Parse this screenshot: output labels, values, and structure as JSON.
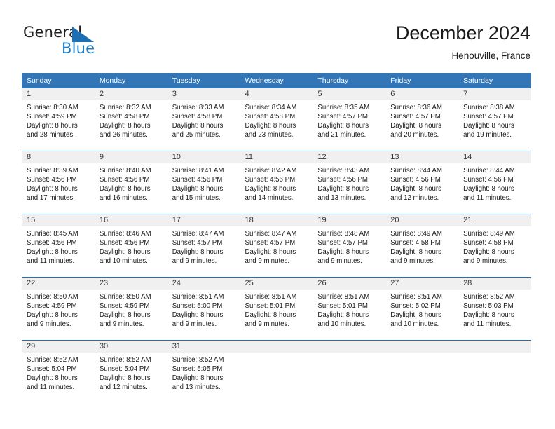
{
  "brand": {
    "name_part1": "General",
    "name_part2": "Blue",
    "flag_icon": "blue-triangle-flag-icon"
  },
  "header": {
    "title": "December 2024",
    "location": "Henouville, France"
  },
  "colors": {
    "header_blue": "#3376b8",
    "rule_blue": "#2b6cad",
    "daynum_band": "#f0f0f0",
    "brand_blue": "#1c7ec6"
  },
  "weekday_headers": [
    "Sunday",
    "Monday",
    "Tuesday",
    "Wednesday",
    "Thursday",
    "Friday",
    "Saturday"
  ],
  "weeks": [
    {
      "days": [
        {
          "day": "1",
          "sunrise": "Sunrise: 8:30 AM",
          "sunset": "Sunset: 4:59 PM",
          "daylight1": "Daylight: 8 hours",
          "daylight2": "and 28 minutes."
        },
        {
          "day": "2",
          "sunrise": "Sunrise: 8:32 AM",
          "sunset": "Sunset: 4:58 PM",
          "daylight1": "Daylight: 8 hours",
          "daylight2": "and 26 minutes."
        },
        {
          "day": "3",
          "sunrise": "Sunrise: 8:33 AM",
          "sunset": "Sunset: 4:58 PM",
          "daylight1": "Daylight: 8 hours",
          "daylight2": "and 25 minutes."
        },
        {
          "day": "4",
          "sunrise": "Sunrise: 8:34 AM",
          "sunset": "Sunset: 4:58 PM",
          "daylight1": "Daylight: 8 hours",
          "daylight2": "and 23 minutes."
        },
        {
          "day": "5",
          "sunrise": "Sunrise: 8:35 AM",
          "sunset": "Sunset: 4:57 PM",
          "daylight1": "Daylight: 8 hours",
          "daylight2": "and 21 minutes."
        },
        {
          "day": "6",
          "sunrise": "Sunrise: 8:36 AM",
          "sunset": "Sunset: 4:57 PM",
          "daylight1": "Daylight: 8 hours",
          "daylight2": "and 20 minutes."
        },
        {
          "day": "7",
          "sunrise": "Sunrise: 8:38 AM",
          "sunset": "Sunset: 4:57 PM",
          "daylight1": "Daylight: 8 hours",
          "daylight2": "and 19 minutes."
        }
      ]
    },
    {
      "days": [
        {
          "day": "8",
          "sunrise": "Sunrise: 8:39 AM",
          "sunset": "Sunset: 4:56 PM",
          "daylight1": "Daylight: 8 hours",
          "daylight2": "and 17 minutes."
        },
        {
          "day": "9",
          "sunrise": "Sunrise: 8:40 AM",
          "sunset": "Sunset: 4:56 PM",
          "daylight1": "Daylight: 8 hours",
          "daylight2": "and 16 minutes."
        },
        {
          "day": "10",
          "sunrise": "Sunrise: 8:41 AM",
          "sunset": "Sunset: 4:56 PM",
          "daylight1": "Daylight: 8 hours",
          "daylight2": "and 15 minutes."
        },
        {
          "day": "11",
          "sunrise": "Sunrise: 8:42 AM",
          "sunset": "Sunset: 4:56 PM",
          "daylight1": "Daylight: 8 hours",
          "daylight2": "and 14 minutes."
        },
        {
          "day": "12",
          "sunrise": "Sunrise: 8:43 AM",
          "sunset": "Sunset: 4:56 PM",
          "daylight1": "Daylight: 8 hours",
          "daylight2": "and 13 minutes."
        },
        {
          "day": "13",
          "sunrise": "Sunrise: 8:44 AM",
          "sunset": "Sunset: 4:56 PM",
          "daylight1": "Daylight: 8 hours",
          "daylight2": "and 12 minutes."
        },
        {
          "day": "14",
          "sunrise": "Sunrise: 8:44 AM",
          "sunset": "Sunset: 4:56 PM",
          "daylight1": "Daylight: 8 hours",
          "daylight2": "and 11 minutes."
        }
      ]
    },
    {
      "days": [
        {
          "day": "15",
          "sunrise": "Sunrise: 8:45 AM",
          "sunset": "Sunset: 4:56 PM",
          "daylight1": "Daylight: 8 hours",
          "daylight2": "and 11 minutes."
        },
        {
          "day": "16",
          "sunrise": "Sunrise: 8:46 AM",
          "sunset": "Sunset: 4:56 PM",
          "daylight1": "Daylight: 8 hours",
          "daylight2": "and 10 minutes."
        },
        {
          "day": "17",
          "sunrise": "Sunrise: 8:47 AM",
          "sunset": "Sunset: 4:57 PM",
          "daylight1": "Daylight: 8 hours",
          "daylight2": "and 9 minutes."
        },
        {
          "day": "18",
          "sunrise": "Sunrise: 8:47 AM",
          "sunset": "Sunset: 4:57 PM",
          "daylight1": "Daylight: 8 hours",
          "daylight2": "and 9 minutes."
        },
        {
          "day": "19",
          "sunrise": "Sunrise: 8:48 AM",
          "sunset": "Sunset: 4:57 PM",
          "daylight1": "Daylight: 8 hours",
          "daylight2": "and 9 minutes."
        },
        {
          "day": "20",
          "sunrise": "Sunrise: 8:49 AM",
          "sunset": "Sunset: 4:58 PM",
          "daylight1": "Daylight: 8 hours",
          "daylight2": "and 9 minutes."
        },
        {
          "day": "21",
          "sunrise": "Sunrise: 8:49 AM",
          "sunset": "Sunset: 4:58 PM",
          "daylight1": "Daylight: 8 hours",
          "daylight2": "and 9 minutes."
        }
      ]
    },
    {
      "days": [
        {
          "day": "22",
          "sunrise": "Sunrise: 8:50 AM",
          "sunset": "Sunset: 4:59 PM",
          "daylight1": "Daylight: 8 hours",
          "daylight2": "and 9 minutes."
        },
        {
          "day": "23",
          "sunrise": "Sunrise: 8:50 AM",
          "sunset": "Sunset: 4:59 PM",
          "daylight1": "Daylight: 8 hours",
          "daylight2": "and 9 minutes."
        },
        {
          "day": "24",
          "sunrise": "Sunrise: 8:51 AM",
          "sunset": "Sunset: 5:00 PM",
          "daylight1": "Daylight: 8 hours",
          "daylight2": "and 9 minutes."
        },
        {
          "day": "25",
          "sunrise": "Sunrise: 8:51 AM",
          "sunset": "Sunset: 5:01 PM",
          "daylight1": "Daylight: 8 hours",
          "daylight2": "and 9 minutes."
        },
        {
          "day": "26",
          "sunrise": "Sunrise: 8:51 AM",
          "sunset": "Sunset: 5:01 PM",
          "daylight1": "Daylight: 8 hours",
          "daylight2": "and 10 minutes."
        },
        {
          "day": "27",
          "sunrise": "Sunrise: 8:51 AM",
          "sunset": "Sunset: 5:02 PM",
          "daylight1": "Daylight: 8 hours",
          "daylight2": "and 10 minutes."
        },
        {
          "day": "28",
          "sunrise": "Sunrise: 8:52 AM",
          "sunset": "Sunset: 5:03 PM",
          "daylight1": "Daylight: 8 hours",
          "daylight2": "and 11 minutes."
        }
      ]
    },
    {
      "days": [
        {
          "day": "29",
          "sunrise": "Sunrise: 8:52 AM",
          "sunset": "Sunset: 5:04 PM",
          "daylight1": "Daylight: 8 hours",
          "daylight2": "and 11 minutes."
        },
        {
          "day": "30",
          "sunrise": "Sunrise: 8:52 AM",
          "sunset": "Sunset: 5:04 PM",
          "daylight1": "Daylight: 8 hours",
          "daylight2": "and 12 minutes."
        },
        {
          "day": "31",
          "sunrise": "Sunrise: 8:52 AM",
          "sunset": "Sunset: 5:05 PM",
          "daylight1": "Daylight: 8 hours",
          "daylight2": "and 13 minutes."
        },
        {
          "day": "",
          "sunrise": "",
          "sunset": "",
          "daylight1": "",
          "daylight2": ""
        },
        {
          "day": "",
          "sunrise": "",
          "sunset": "",
          "daylight1": "",
          "daylight2": ""
        },
        {
          "day": "",
          "sunrise": "",
          "sunset": "",
          "daylight1": "",
          "daylight2": ""
        },
        {
          "day": "",
          "sunrise": "",
          "sunset": "",
          "daylight1": "",
          "daylight2": ""
        }
      ]
    }
  ]
}
